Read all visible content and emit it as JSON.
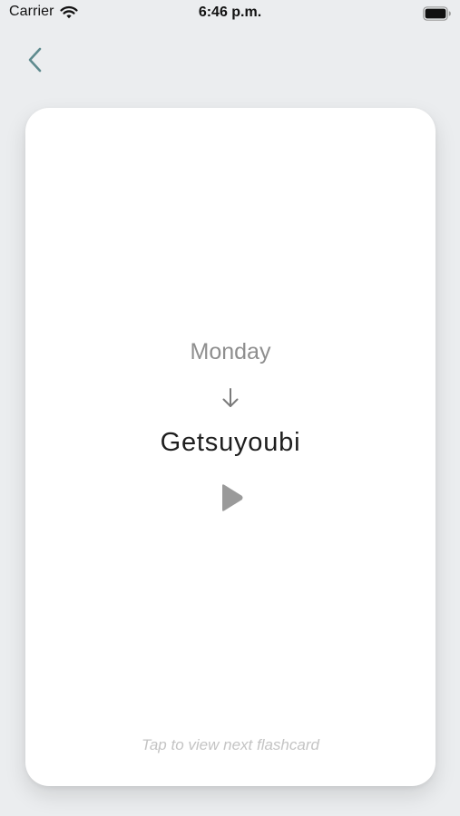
{
  "status_bar": {
    "carrier": "Carrier",
    "time": "6:46 p.m.",
    "wifi_icon": "wifi-icon",
    "battery_icon": "battery-full-icon"
  },
  "nav": {
    "back_icon": "chevron-left-icon"
  },
  "flashcard": {
    "english": "Monday",
    "arrow_icon": "arrow-down-icon",
    "translation": "Getsuyoubi",
    "play_icon": "play-icon",
    "hint": "Tap to view next flashcard"
  },
  "colors": {
    "background": "#ebedef",
    "card": "#ffffff",
    "accent": "#5e8a8e",
    "english_text": "#8e8e8e",
    "translation_text": "#1e1e1e",
    "hint_text": "#c4c4c4"
  }
}
